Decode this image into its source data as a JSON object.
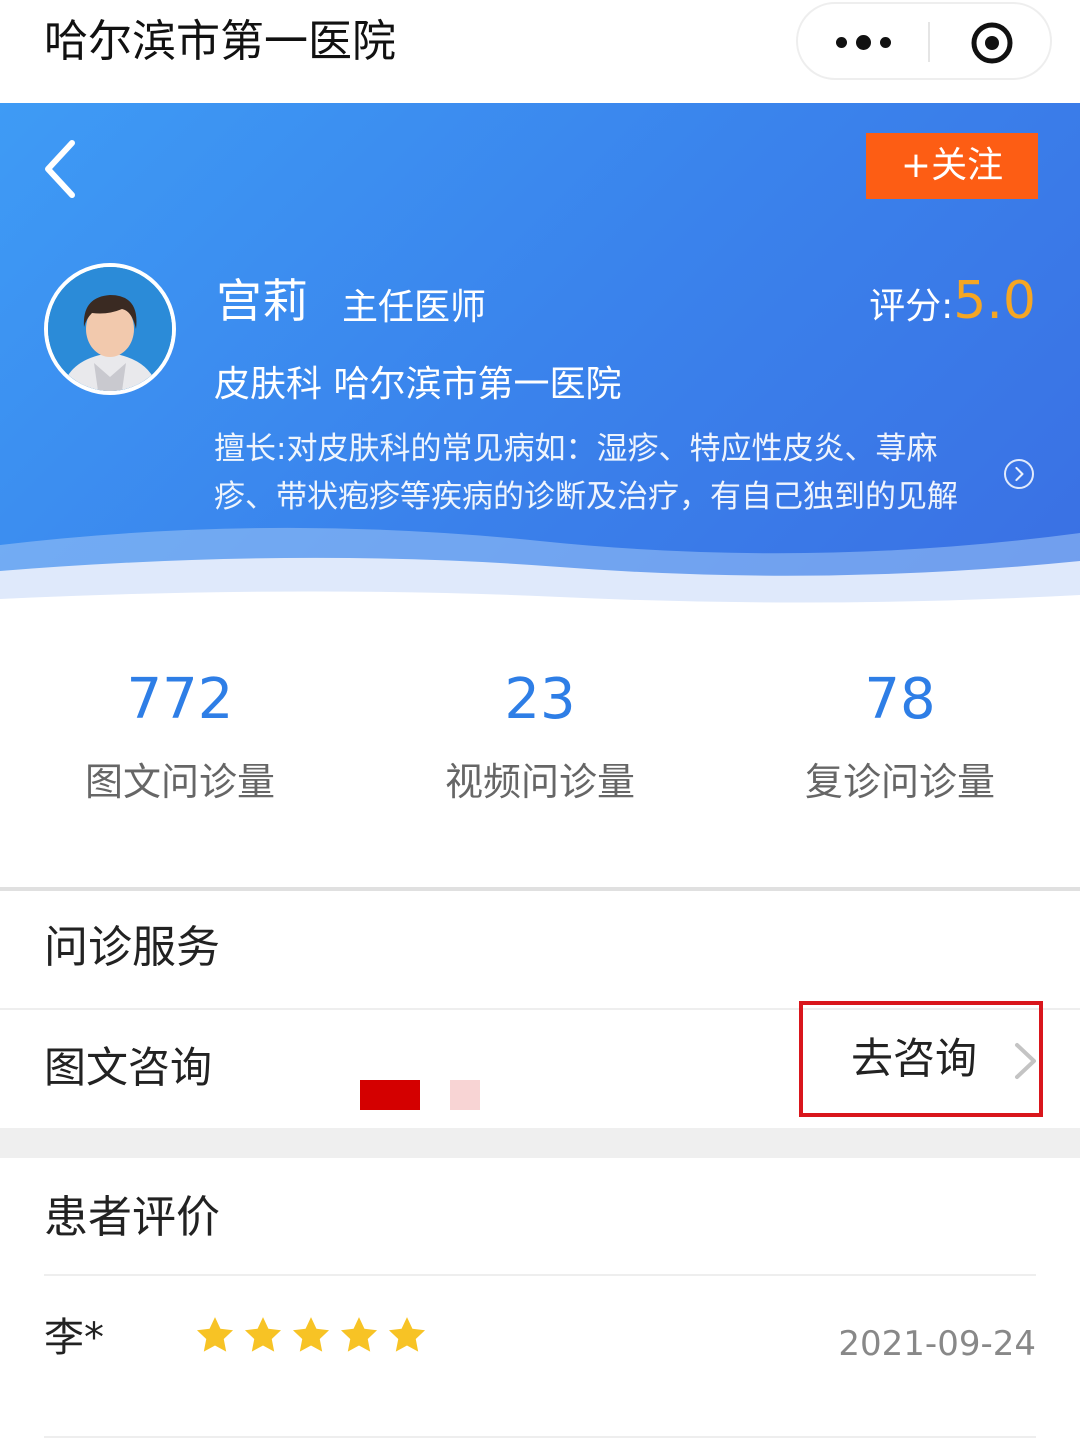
{
  "topbar": {
    "title": "哈尔滨市第一医院",
    "more_icon": "more-dots-icon",
    "close_icon": "close-miniprogram-icon"
  },
  "doctor": {
    "follow_label": "+关注",
    "name": "宫莉",
    "title": "主任医师",
    "score_label": "评分:",
    "score_value": "5.0",
    "department": "皮肤科 哈尔滨市第一医院",
    "expertise": "擅长:对皮肤科的常见病如：湿疹、特应性皮炎、荨麻疹、带状疱疹等疾病的诊断及治疗，有自己独到的见解",
    "colors": {
      "header_start": "#3e9bf5",
      "header_end": "#3a6fe3",
      "follow_bg": "#fd5d14",
      "score": "#f5a623"
    }
  },
  "stats": [
    {
      "value": "772",
      "label": "图文问诊量"
    },
    {
      "value": "23",
      "label": "视频问诊量"
    },
    {
      "value": "78",
      "label": "复诊问诊量"
    }
  ],
  "consultation": {
    "section_title": "问诊服务",
    "service_label": "图文咨询",
    "action_label": "去咨询",
    "highlight_color": "#d9161c"
  },
  "reviews": {
    "section_title": "患者评价",
    "items": [
      {
        "name": "李*",
        "stars": 5,
        "date": "2021-09-24"
      }
    ]
  }
}
